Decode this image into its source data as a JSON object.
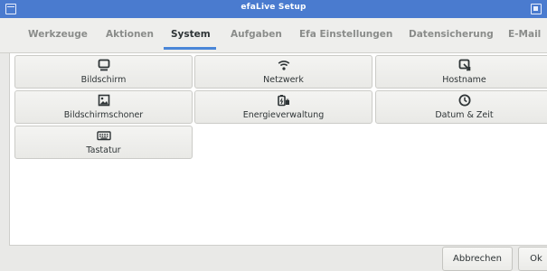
{
  "window": {
    "title": "efaLive Setup"
  },
  "tabs": [
    {
      "label": "Werkzeuge"
    },
    {
      "label": "Aktionen"
    },
    {
      "label": "System",
      "active": true
    },
    {
      "label": "Aufgaben"
    },
    {
      "label": "Efa Einstellungen"
    },
    {
      "label": "Datensicherung"
    },
    {
      "label": "E-Mail"
    }
  ],
  "tiles": [
    {
      "label": "Bildschirm",
      "icon": "monitor-icon"
    },
    {
      "label": "Netzwerk",
      "icon": "wifi-icon"
    },
    {
      "label": "Hostname",
      "icon": "hostname-icon"
    },
    {
      "label": "Bildschirmschoner",
      "icon": "screensaver-icon"
    },
    {
      "label": "Energieverwaltung",
      "icon": "power-management-icon"
    },
    {
      "label": "Datum & Zeit",
      "icon": "clock-icon"
    },
    {
      "label": "Tastatur",
      "icon": "keyboard-icon"
    }
  ],
  "buttons": {
    "cancel": "Abbrechen",
    "ok": "Ok"
  },
  "colors": {
    "titlebar": "#4a7bcf",
    "tab_active_underline": "#4a86d8"
  }
}
